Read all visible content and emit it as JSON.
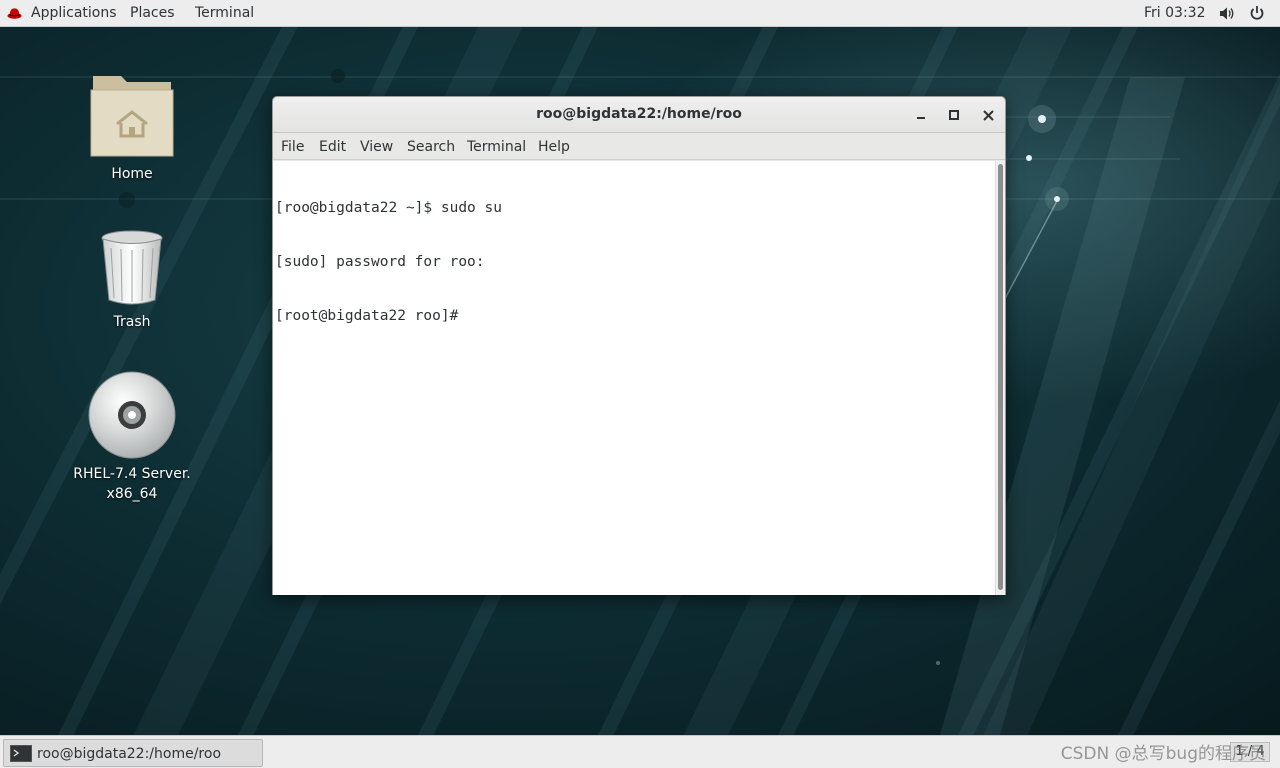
{
  "topbar": {
    "applications_label": "Applications",
    "places_label": "Places",
    "terminal_label": "Terminal",
    "clock": "Fri 03:32"
  },
  "desktop_icons": [
    {
      "label": "Home",
      "icon": "home-folder-icon"
    },
    {
      "label": "Trash",
      "icon": "trash-icon"
    },
    {
      "label_line1": "RHEL-7.4 Server.",
      "label_line2": "x86_64",
      "icon": "optical-disc-icon"
    }
  ],
  "terminal_window": {
    "title": "roo@bigdata22:/home/roo",
    "menu": [
      "File",
      "Edit",
      "View",
      "Search",
      "Terminal",
      "Help"
    ],
    "lines": [
      "[roo@bigdata22 ~]$ sudo su",
      "[sudo] password for roo:",
      "[root@bigdata22 roo]#"
    ]
  },
  "taskbar": {
    "window_label": "roo@bigdata22:/home/roo",
    "workspace": "1 / 4",
    "watermark": "CSDN @总写bug的程序员"
  },
  "colors": {
    "desktop_bg": "#0c2a30",
    "panel_bg": "#ededed",
    "terminal_bg": "#ffffff",
    "redhat_red": "#cc0000"
  }
}
